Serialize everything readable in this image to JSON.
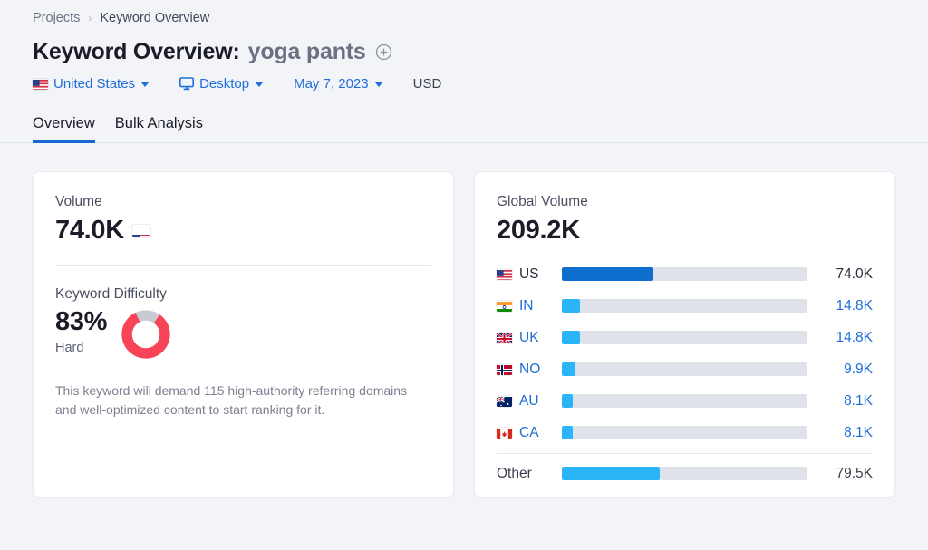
{
  "breadcrumb": {
    "parent": "Projects",
    "separator": "›",
    "current": "Keyword Overview"
  },
  "header": {
    "title": "Keyword Overview:",
    "keyword": "yoga pants",
    "add_icon": "plus-circle-icon"
  },
  "filters": {
    "country": {
      "label": "United States",
      "flag": "us-flag-icon",
      "caret": "chevron-down-icon"
    },
    "device": {
      "label": "Desktop",
      "icon": "desktop-monitor-icon",
      "caret": "chevron-down-icon"
    },
    "date": {
      "label": "May 7, 2023",
      "caret": "chevron-down-icon"
    },
    "currency": {
      "label": "USD"
    }
  },
  "tabs": [
    {
      "label": "Overview",
      "active": true
    },
    {
      "label": "Bulk Analysis",
      "active": false
    }
  ],
  "volume_card": {
    "label": "Volume",
    "value": "74.0K",
    "flag": "us-flag-icon",
    "difficulty": {
      "label": "Keyword Difficulty",
      "percent": "83%",
      "percent_value": 83,
      "rating": "Hard",
      "description": "This keyword will demand 115 high-authority referring domains and well-optimized content to start ranking for it.",
      "donut_color": "#f94356",
      "donut_track_color": "#c9cbd4"
    }
  },
  "global_card": {
    "label": "Global Volume",
    "value": "209.2K"
  },
  "chart_data": {
    "type": "bar",
    "title": "Global Volume",
    "orientation": "horizontal",
    "total": "209.2K",
    "total_value": 209200,
    "xlabel": "",
    "ylabel": "",
    "grid": false,
    "legend": false,
    "colors": {
      "current": "#0d6ecd",
      "other": "#2cb4f9",
      "track": "#e0e2ea"
    },
    "categories": [
      "US",
      "IN",
      "UK",
      "NO",
      "AU",
      "CA",
      "Other"
    ],
    "values": [
      74000,
      14800,
      14800,
      9900,
      8100,
      8100,
      79500
    ],
    "rows": [
      {
        "code": "US",
        "flag": "us-flag-icon",
        "value": "74.0K",
        "value_num": 74000,
        "pct": 37.2,
        "current": true
      },
      {
        "code": "IN",
        "flag": "in-flag-icon",
        "value": "14.8K",
        "value_num": 14800,
        "pct": 7.5,
        "current": false
      },
      {
        "code": "UK",
        "flag": "uk-flag-icon",
        "value": "14.8K",
        "value_num": 14800,
        "pct": 7.5,
        "current": false
      },
      {
        "code": "NO",
        "flag": "no-flag-icon",
        "value": "9.9K",
        "value_num": 9900,
        "pct": 5.4,
        "current": false
      },
      {
        "code": "AU",
        "flag": "au-flag-icon",
        "value": "8.1K",
        "value_num": 8100,
        "pct": 4.6,
        "current": false
      },
      {
        "code": "CA",
        "flag": "ca-flag-icon",
        "value": "8.1K",
        "value_num": 8100,
        "pct": 4.6,
        "current": false
      }
    ],
    "other_row": {
      "code": "Other",
      "value": "79.5K",
      "value_num": 79500,
      "pct": 40.0
    }
  }
}
